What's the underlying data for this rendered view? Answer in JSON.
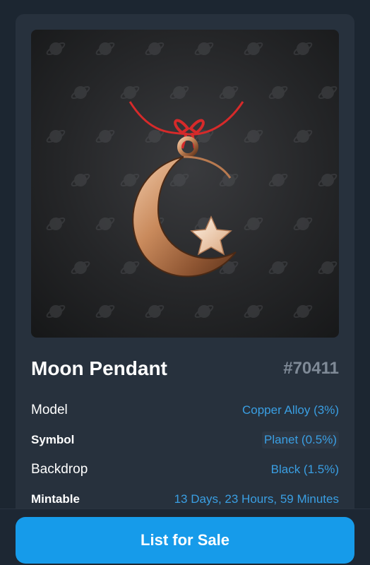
{
  "gift": {
    "name": "Moon Pendant",
    "number": "#70411"
  },
  "attributes": [
    {
      "label": "Model",
      "value": "Copper Alloy (3%)"
    },
    {
      "label": "Symbol",
      "value": "Planet (0.5%)"
    },
    {
      "label": "Backdrop",
      "value": "Black (1.5%)"
    },
    {
      "label": "Mintable",
      "value": "13 Days, 23 Hours, 59 Minutes"
    }
  ],
  "actions": {
    "list_for_sale": "List for Sale"
  },
  "artwork": {
    "pattern_icon": "planet-icon",
    "subject_icon": "moon-pendant-icon"
  },
  "colors": {
    "accent": "#169bea",
    "value_text": "#3a9fe3",
    "card_bg": "#27313d",
    "page_bg": "#1c2631"
  }
}
